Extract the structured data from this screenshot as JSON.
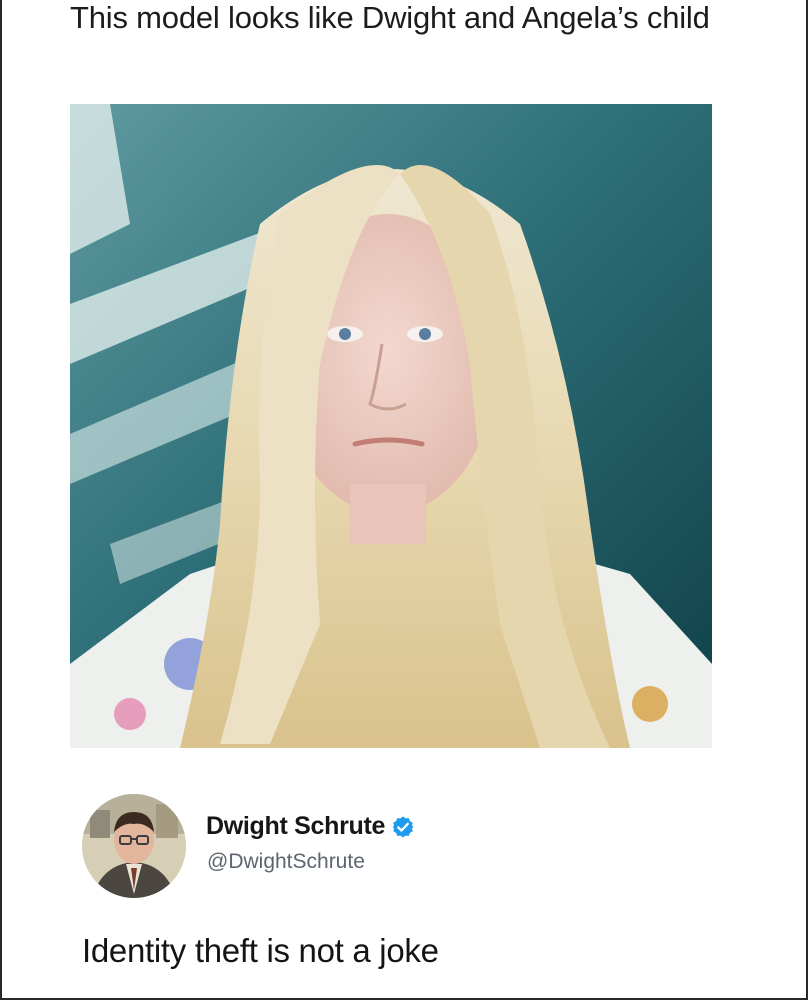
{
  "post": {
    "caption": "This model looks like Dwight and Angela’s child"
  },
  "tweet": {
    "display_name": "Dwight Schrute",
    "handle": "@DwightSchrute",
    "text": "Identity theft is not a joke",
    "verified": true,
    "verified_icon": "verified-badge-icon",
    "verified_color": "#1d9bf0"
  },
  "colors": {
    "background": "#ffffff",
    "handle": "#5d6670"
  }
}
